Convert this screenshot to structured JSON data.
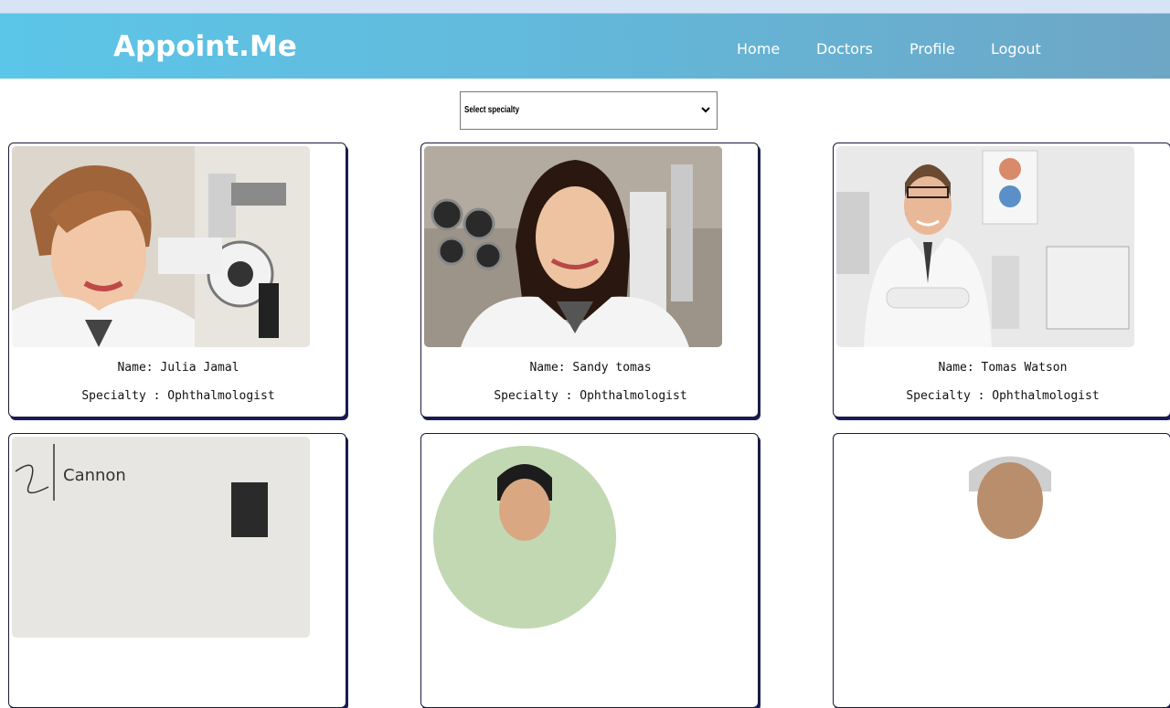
{
  "header": {
    "brand": "Appoint.Me",
    "nav": [
      {
        "label": "Home"
      },
      {
        "label": "Doctors"
      },
      {
        "label": "Profile"
      },
      {
        "label": "Logout"
      }
    ]
  },
  "filter": {
    "selected": "Select specialty"
  },
  "doctors": [
    {
      "name": "Name: Julia Jamal",
      "specialty": "Specialty : Ophthalmologist"
    },
    {
      "name": "Name: Sandy tomas",
      "specialty": "Specialty : Ophthalmologist"
    },
    {
      "name": "Name: Tomas Watson",
      "specialty": "Specialty : Ophthalmologist"
    },
    {
      "name": "",
      "specialty": "",
      "photo_text": "Cannon"
    },
    {
      "name": "",
      "specialty": ""
    },
    {
      "name": "",
      "specialty": ""
    }
  ],
  "colors": {
    "header_start": "#5cc6e8",
    "header_end": "#6ea6c6",
    "card_border": "#1a1a3a"
  }
}
